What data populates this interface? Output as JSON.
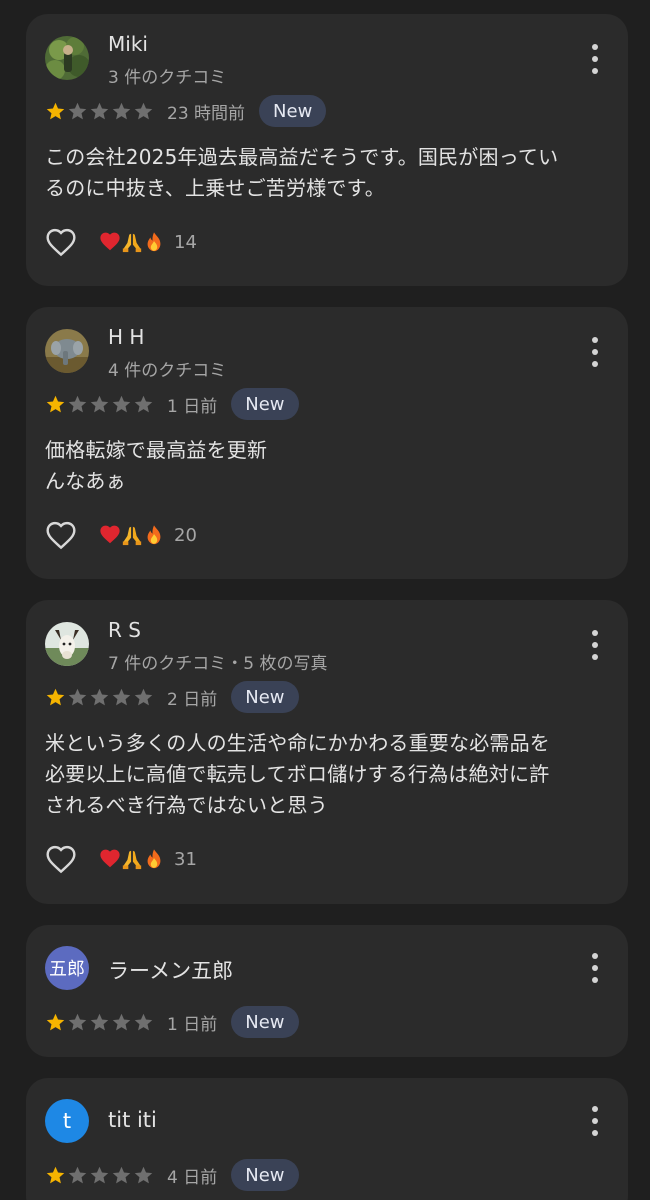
{
  "reviews": [
    {
      "name": "Miki",
      "meta": "3 件のクチコミ",
      "rating": 1,
      "time": "23 時間前",
      "badge": "New",
      "text": [
        "この会社2025年過去最高益だそうです。国民が困ってい",
        "るのに中抜き、上乗せご苦労様です。"
      ],
      "reaction_count": "14",
      "avatar": "photo-green-icon"
    },
    {
      "name": "H H",
      "meta": "4 件のクチコミ",
      "rating": 1,
      "time": "1 日前",
      "badge": "New",
      "text": [
        "価格転嫁で最高益を更新",
        "んなあぁ"
      ],
      "reaction_count": "20",
      "avatar": "photo-elephant-icon"
    },
    {
      "name": "R S",
      "meta": "7 件のクチコミ・5 枚の写真",
      "rating": 1,
      "time": "2 日前",
      "badge": "New",
      "text": [
        "米という多くの人の生活や命にかかわる重要な必需品を",
        "必要以上に高値で転売してボロ儲けする行為は絶対に許",
        "されるべき行為ではないと思う"
      ],
      "reaction_count": "31",
      "avatar": "photo-goat-icon"
    },
    {
      "name": "ラーメン五郎",
      "avatar_text": "五郎",
      "avatar_color": "#5c6bc0",
      "rating": 1,
      "time": "1 日前",
      "badge": "New"
    },
    {
      "name": "tit iti",
      "avatar_text": "t",
      "avatar_color": "#1e88e5",
      "rating": 1,
      "time": "4 日前",
      "badge": "New"
    }
  ],
  "colors": {
    "background": "#1f1f1f",
    "card": "#2b2b2b",
    "star_filled": "#f6b400",
    "star_empty": "#6f6f6f",
    "badge_bg": "#3a4256"
  },
  "icons": {
    "more": "more-vertical-icon",
    "like": "heart-outline-icon",
    "reactions": [
      "red-heart-icon",
      "folded-hands-icon",
      "fire-icon"
    ]
  }
}
